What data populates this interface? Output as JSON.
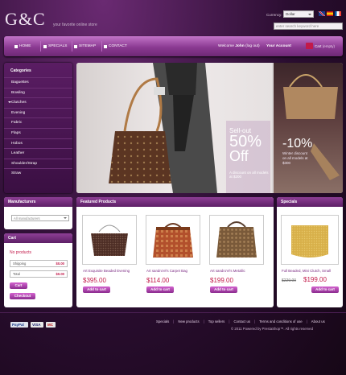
{
  "header": {
    "logo": "G&C",
    "slogan": "your favorite online store",
    "currency_label": "Currency:",
    "currency_value": "Dollar",
    "search_placeholder": "enter search keyword here",
    "flags": [
      "uk-flag",
      "spain-flag",
      "france-flag"
    ]
  },
  "nav": {
    "items": [
      "HOME",
      "SPECIALS",
      "SITEMAP",
      "CONTACT"
    ],
    "welcome_prefix": "Welcome",
    "welcome_user": "John",
    "welcome_suffix": "(log out)",
    "account": "Your Account",
    "cart": "Cart",
    "cart_status": "(empty)"
  },
  "categories": {
    "title": "Categories",
    "items": [
      "Baguettes",
      "Bowling",
      "Clutches",
      "Evening",
      "Fabric",
      "Flaps",
      "Hobos",
      "Leather",
      "Shoulder/Strap",
      "Straw"
    ],
    "active_index": 2
  },
  "banner": {
    "promo1_line1": "Sell-out",
    "promo1_line2": "50%",
    "promo1_line3": "Off",
    "promo1_note": "A discount on all models at $200",
    "promo2_pct": "-10%",
    "promo2_note": "Winter discount on all models at $300"
  },
  "manufacturers": {
    "title": "Manufacturers",
    "select_value": "All manufacturers"
  },
  "cart": {
    "title": "Cart",
    "empty_text": "No products",
    "shipping_label": "Shipping",
    "shipping_value": "$0.00",
    "total_label": "Total",
    "total_value": "$0.00",
    "cart_button": "Cart",
    "checkout_button": "Checkout"
  },
  "featured": {
    "title": "Featured Products",
    "add_label": "Add to cart",
    "products": [
      {
        "name": "Art Exquisite Beaded Evening",
        "price": "$395.00"
      },
      {
        "name": "Art sandro'el's Carpet Bag",
        "price": "$114.00"
      },
      {
        "name": "Art sandro'el's Metallic",
        "price": "$199.00"
      }
    ]
  },
  "specials": {
    "title": "Specials",
    "product_name": "Full Beaded, Mini Clutch, Small",
    "old_price": "$229.00",
    "price": "$199.00",
    "add_label": "Add to cart"
  },
  "footer": {
    "payments": [
      "PayPal",
      "VISA",
      "MC"
    ],
    "links": [
      "Specials",
      "New products",
      "Top sellers",
      "Contact us",
      "Terms and conditions of use",
      "About us"
    ],
    "copyright": "© 2011 Powered by PrestaShop™. All rights reserved"
  },
  "colors": {
    "accent": "#8b3a92",
    "price": "#c21a4a"
  }
}
